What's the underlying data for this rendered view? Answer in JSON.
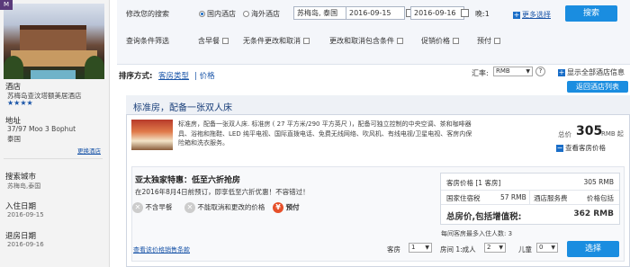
{
  "sidebar": {
    "tag": "M",
    "hotel_label": "酒店",
    "hotel_name": "苏梅岛查汶塔额美居酒店",
    "stars": "★★★★",
    "address_label": "地址",
    "address_line1": "37/97 Moo 3 Bophut",
    "address_line2": "泰国",
    "change_hotel": "更换酒店",
    "search_city_label": "搜索城市",
    "search_city": "苏梅岛,泰国",
    "checkin_label": "入住日期",
    "checkin": "2016-09-15",
    "checkout_label": "退房日期",
    "checkout": "2016-09-16"
  },
  "search": {
    "label": "修改您的搜索",
    "domestic": "国内酒店",
    "overseas": "海外酒店",
    "city": "苏梅岛, 泰国",
    "date_in": "2016-09-15",
    "date_out": "2016-09-16",
    "nights": "晚:1",
    "more": "更多选择",
    "search_btn": "搜索"
  },
  "filters": {
    "label": "查询条件筛选",
    "breakfast": "含早餐",
    "no_change": "无条件更改和取消",
    "conditional": "更改和取消包含条件",
    "promo": "促销价格",
    "prepay": "预付"
  },
  "sortbar": {
    "label": "排序方式:",
    "room_type": "客房类型",
    "price": "| 价格",
    "rate_label": "汇率:",
    "currency": "RMB",
    "help": "?",
    "show_all": "显示全部酒店信息",
    "back": "返回酒店列表"
  },
  "room": {
    "title": "标准房，配备一张双人床",
    "desc": "标准房，配备一张双人床. 标准房 ( 27 平方米/290 平方英尺 )，配备可独立控制的中央空调、茶和咖啡器具、浴袍和拖鞋、LED 纯平电视、国际直拨电话、免费无线网络、吹风机、有线电视/卫星电视、客房内保险箱和洗衣服务。",
    "total_prefix": "总价",
    "total_price": "305",
    "total_suffix": "RMB 起",
    "view_price": "查看客房价格"
  },
  "offer": {
    "title": "亚太独家特惠：低至六折抢房",
    "sub": "在2016年8月4日前预订，即享低至六折优惠！不容错过！",
    "no_breakfast": "不含早餐",
    "no_cancel": "不能取消和更改的价格",
    "prepay": "预付",
    "terms": "查看该价格销售条款",
    "room_price_label": "客房价格 [1 客房]",
    "room_price": "305 RMB",
    "tax_label": "国家住宿税",
    "tax": "57 RMB",
    "service_label": "酒店服务费",
    "service": "价格包括",
    "total_label": "总房价,包括增值税:",
    "total": "362 RMB",
    "max_guests": "每间客房最多入住人数: 3",
    "rooms_label": "客房",
    "rooms_val": "1",
    "room_adult_label": "房间 1:成人",
    "adult_val": "2",
    "children_label": "儿童",
    "children_val": "0",
    "select_btn": "选择"
  }
}
